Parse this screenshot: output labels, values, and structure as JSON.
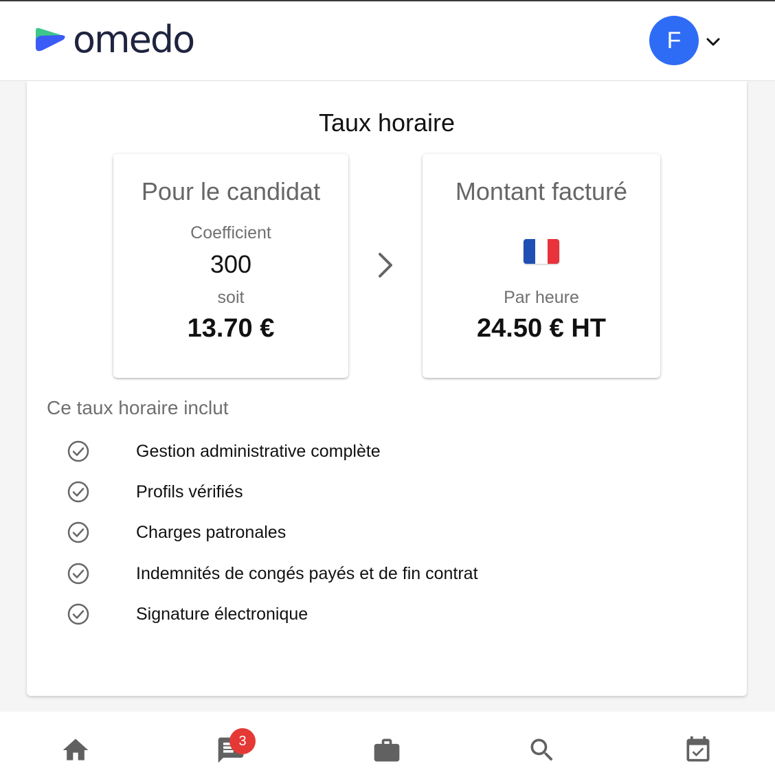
{
  "header": {
    "brand": "omedo",
    "avatar_initial": "F",
    "colors": {
      "brand_dark": "#1f2440",
      "brand_green": "#3ec78c",
      "brand_blue": "#3b5bf6",
      "avatar": "#2f6cf6"
    }
  },
  "rate": {
    "title": "Taux horaire",
    "candidate": {
      "title": "Pour le candidat",
      "coefficient_label": "Coefficient",
      "coefficient_value": "300",
      "soit_label": "soit",
      "price": "13.70 €"
    },
    "billed": {
      "title": "Montant facturé",
      "flag": "france-flag",
      "per_hour_label": "Par heure",
      "price": "24.50 € HT"
    }
  },
  "includes": {
    "title": "Ce taux horaire inclut",
    "items": [
      "Gestion administrative complète",
      "Profils vérifiés",
      "Charges patronales",
      "Indemnités de congés payés et de fin contrat",
      "Signature électronique"
    ]
  },
  "bottom_nav": {
    "items": [
      {
        "icon": "home-icon"
      },
      {
        "icon": "messages-icon",
        "badge": "3"
      },
      {
        "icon": "briefcase-icon"
      },
      {
        "icon": "search-icon"
      },
      {
        "icon": "calendar-check-icon"
      }
    ],
    "badge_color": "#e53935"
  }
}
